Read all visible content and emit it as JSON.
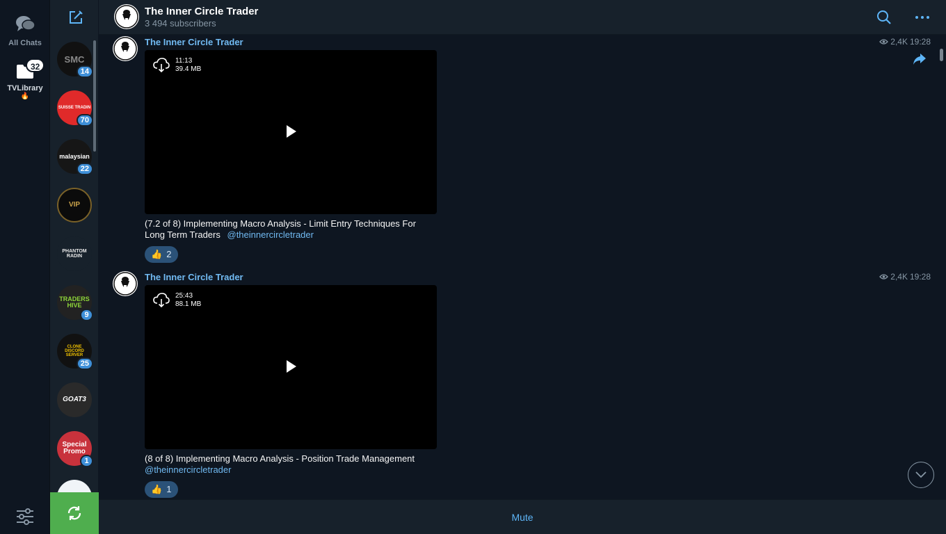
{
  "folders": {
    "all_chats_label": "All Chats",
    "tvlibrary_label": "TVLibrary",
    "tvlibrary_emoji": "🔥",
    "tvlibrary_badge": "32"
  },
  "chat_list": [
    {
      "name": "SMC",
      "avatar_text": "SMC",
      "unread": "14"
    },
    {
      "name": "Suisse Trading",
      "avatar_text": "SUISSE TRADIN",
      "unread": "70"
    },
    {
      "name": "malaysian",
      "avatar_text": "malaysian",
      "unread": "22"
    },
    {
      "name": "VIP",
      "avatar_text": "VIP",
      "unread": ""
    },
    {
      "name": "Phantom Radin",
      "avatar_text": "PHANTOM RADIN",
      "unread": ""
    },
    {
      "name": "Traders Hive",
      "avatar_text": "TRADERS HIVE",
      "unread": "9"
    },
    {
      "name": "Clone Discord Server",
      "avatar_text": "CLONE DISCORD SERVER",
      "unread": "25"
    },
    {
      "name": "Goat3",
      "avatar_text": "GOAT3",
      "unread": ""
    },
    {
      "name": "Special Promo",
      "avatar_text": "Special Promo",
      "unread": "1"
    }
  ],
  "header": {
    "title": "The Inner Circle Trader",
    "subtitle": "3 494 subscribers"
  },
  "messages": [
    {
      "author": "The Inner Circle Trader",
      "views": "2,4K",
      "time": "19:28",
      "video_duration": "11:13",
      "video_size": "39.4 MB",
      "caption": "(7.2 of 8) Implementing Macro Analysis - Limit Entry Techniques For Long Term Traders",
      "mention": "@theinnercircletrader",
      "reaction_emoji": "👍",
      "reaction_count": "2"
    },
    {
      "author": "The Inner Circle Trader",
      "views": "2,4K",
      "time": "19:28",
      "video_duration": "25:43",
      "video_size": "88.1 MB",
      "caption": "(8 of 8) Implementing Macro Analysis - Position Trade Management",
      "mention": "@theinnercircletrader",
      "reaction_emoji": "👍",
      "reaction_count": "1"
    }
  ],
  "bottom_bar": {
    "mute_label": "Mute"
  },
  "colors": {
    "accent": "#5eb5f7",
    "author": "#71baf2",
    "unread_badge": "#3e8fd8",
    "refresh_green": "#4fae4e"
  }
}
